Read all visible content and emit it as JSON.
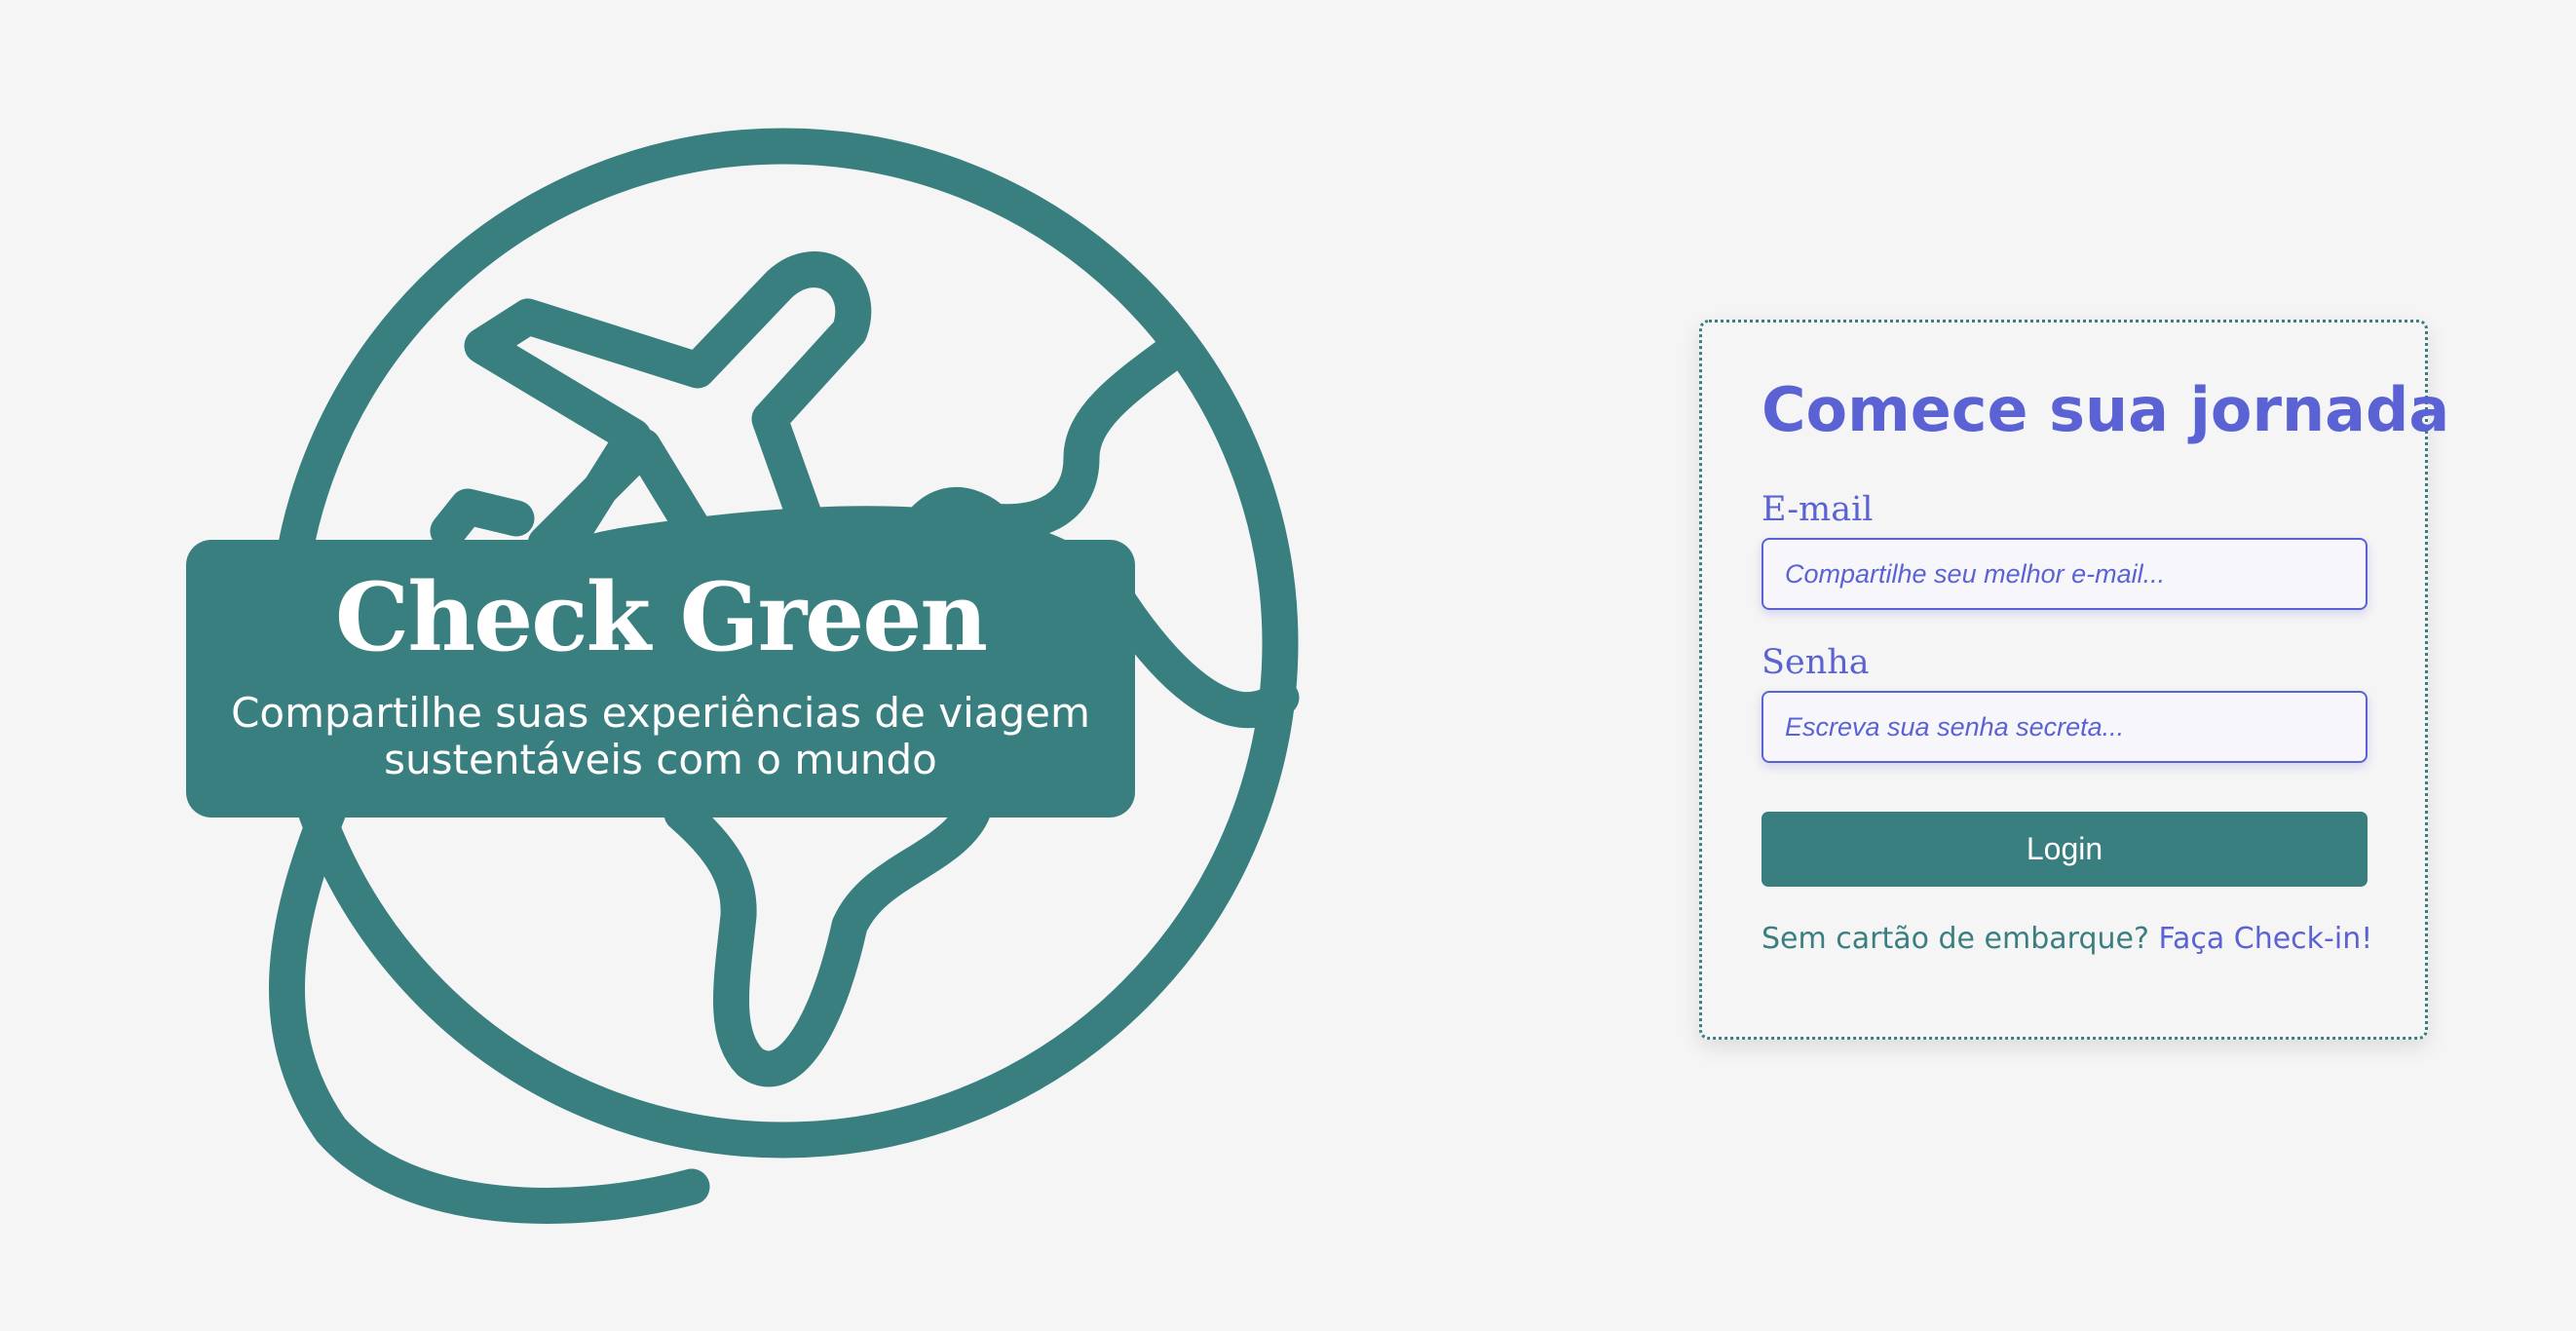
{
  "colors": {
    "background": "#f5f5f5",
    "brand_teal": "#3a7f80",
    "accent_purple": "#5b63d4",
    "button_text": "#ffffff"
  },
  "hero": {
    "icon": "globe-airplane-icon",
    "title": "Check Green",
    "subtitle": "Compartilhe suas experiências de viagem sustentáveis com o mundo"
  },
  "login": {
    "title": "Comece sua jornada",
    "email_label": "E-mail",
    "email_placeholder": "Compartilhe seu melhor e-mail...",
    "password_label": "Senha",
    "password_placeholder": "Escreva sua senha secreta...",
    "submit_label": "Login",
    "checkin_prompt": "Sem cartão de embarque?",
    "checkin_link": "Faça Check-in!"
  }
}
